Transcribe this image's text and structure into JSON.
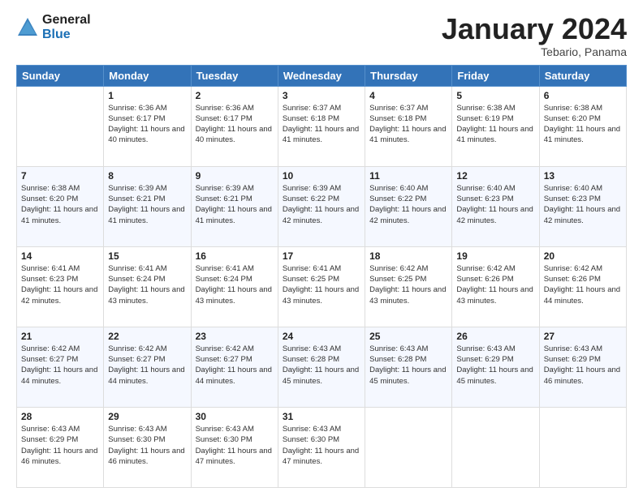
{
  "header": {
    "logo": {
      "general": "General",
      "blue": "Blue"
    },
    "title": "January 2024",
    "subtitle": "Tebario, Panama"
  },
  "calendar": {
    "days_of_week": [
      "Sunday",
      "Monday",
      "Tuesday",
      "Wednesday",
      "Thursday",
      "Friday",
      "Saturday"
    ],
    "weeks": [
      [
        {
          "day": "",
          "sunrise": "",
          "sunset": "",
          "daylight": ""
        },
        {
          "day": "1",
          "sunrise": "Sunrise: 6:36 AM",
          "sunset": "Sunset: 6:17 PM",
          "daylight": "Daylight: 11 hours and 40 minutes."
        },
        {
          "day": "2",
          "sunrise": "Sunrise: 6:36 AM",
          "sunset": "Sunset: 6:17 PM",
          "daylight": "Daylight: 11 hours and 40 minutes."
        },
        {
          "day": "3",
          "sunrise": "Sunrise: 6:37 AM",
          "sunset": "Sunset: 6:18 PM",
          "daylight": "Daylight: 11 hours and 41 minutes."
        },
        {
          "day": "4",
          "sunrise": "Sunrise: 6:37 AM",
          "sunset": "Sunset: 6:18 PM",
          "daylight": "Daylight: 11 hours and 41 minutes."
        },
        {
          "day": "5",
          "sunrise": "Sunrise: 6:38 AM",
          "sunset": "Sunset: 6:19 PM",
          "daylight": "Daylight: 11 hours and 41 minutes."
        },
        {
          "day": "6",
          "sunrise": "Sunrise: 6:38 AM",
          "sunset": "Sunset: 6:20 PM",
          "daylight": "Daylight: 11 hours and 41 minutes."
        }
      ],
      [
        {
          "day": "7",
          "sunrise": "Sunrise: 6:38 AM",
          "sunset": "Sunset: 6:20 PM",
          "daylight": "Daylight: 11 hours and 41 minutes."
        },
        {
          "day": "8",
          "sunrise": "Sunrise: 6:39 AM",
          "sunset": "Sunset: 6:21 PM",
          "daylight": "Daylight: 11 hours and 41 minutes."
        },
        {
          "day": "9",
          "sunrise": "Sunrise: 6:39 AM",
          "sunset": "Sunset: 6:21 PM",
          "daylight": "Daylight: 11 hours and 41 minutes."
        },
        {
          "day": "10",
          "sunrise": "Sunrise: 6:39 AM",
          "sunset": "Sunset: 6:22 PM",
          "daylight": "Daylight: 11 hours and 42 minutes."
        },
        {
          "day": "11",
          "sunrise": "Sunrise: 6:40 AM",
          "sunset": "Sunset: 6:22 PM",
          "daylight": "Daylight: 11 hours and 42 minutes."
        },
        {
          "day": "12",
          "sunrise": "Sunrise: 6:40 AM",
          "sunset": "Sunset: 6:23 PM",
          "daylight": "Daylight: 11 hours and 42 minutes."
        },
        {
          "day": "13",
          "sunrise": "Sunrise: 6:40 AM",
          "sunset": "Sunset: 6:23 PM",
          "daylight": "Daylight: 11 hours and 42 minutes."
        }
      ],
      [
        {
          "day": "14",
          "sunrise": "Sunrise: 6:41 AM",
          "sunset": "Sunset: 6:23 PM",
          "daylight": "Daylight: 11 hours and 42 minutes."
        },
        {
          "day": "15",
          "sunrise": "Sunrise: 6:41 AM",
          "sunset": "Sunset: 6:24 PM",
          "daylight": "Daylight: 11 hours and 43 minutes."
        },
        {
          "day": "16",
          "sunrise": "Sunrise: 6:41 AM",
          "sunset": "Sunset: 6:24 PM",
          "daylight": "Daylight: 11 hours and 43 minutes."
        },
        {
          "day": "17",
          "sunrise": "Sunrise: 6:41 AM",
          "sunset": "Sunset: 6:25 PM",
          "daylight": "Daylight: 11 hours and 43 minutes."
        },
        {
          "day": "18",
          "sunrise": "Sunrise: 6:42 AM",
          "sunset": "Sunset: 6:25 PM",
          "daylight": "Daylight: 11 hours and 43 minutes."
        },
        {
          "day": "19",
          "sunrise": "Sunrise: 6:42 AM",
          "sunset": "Sunset: 6:26 PM",
          "daylight": "Daylight: 11 hours and 43 minutes."
        },
        {
          "day": "20",
          "sunrise": "Sunrise: 6:42 AM",
          "sunset": "Sunset: 6:26 PM",
          "daylight": "Daylight: 11 hours and 44 minutes."
        }
      ],
      [
        {
          "day": "21",
          "sunrise": "Sunrise: 6:42 AM",
          "sunset": "Sunset: 6:27 PM",
          "daylight": "Daylight: 11 hours and 44 minutes."
        },
        {
          "day": "22",
          "sunrise": "Sunrise: 6:42 AM",
          "sunset": "Sunset: 6:27 PM",
          "daylight": "Daylight: 11 hours and 44 minutes."
        },
        {
          "day": "23",
          "sunrise": "Sunrise: 6:42 AM",
          "sunset": "Sunset: 6:27 PM",
          "daylight": "Daylight: 11 hours and 44 minutes."
        },
        {
          "day": "24",
          "sunrise": "Sunrise: 6:43 AM",
          "sunset": "Sunset: 6:28 PM",
          "daylight": "Daylight: 11 hours and 45 minutes."
        },
        {
          "day": "25",
          "sunrise": "Sunrise: 6:43 AM",
          "sunset": "Sunset: 6:28 PM",
          "daylight": "Daylight: 11 hours and 45 minutes."
        },
        {
          "day": "26",
          "sunrise": "Sunrise: 6:43 AM",
          "sunset": "Sunset: 6:29 PM",
          "daylight": "Daylight: 11 hours and 45 minutes."
        },
        {
          "day": "27",
          "sunrise": "Sunrise: 6:43 AM",
          "sunset": "Sunset: 6:29 PM",
          "daylight": "Daylight: 11 hours and 46 minutes."
        }
      ],
      [
        {
          "day": "28",
          "sunrise": "Sunrise: 6:43 AM",
          "sunset": "Sunset: 6:29 PM",
          "daylight": "Daylight: 11 hours and 46 minutes."
        },
        {
          "day": "29",
          "sunrise": "Sunrise: 6:43 AM",
          "sunset": "Sunset: 6:30 PM",
          "daylight": "Daylight: 11 hours and 46 minutes."
        },
        {
          "day": "30",
          "sunrise": "Sunrise: 6:43 AM",
          "sunset": "Sunset: 6:30 PM",
          "daylight": "Daylight: 11 hours and 47 minutes."
        },
        {
          "day": "31",
          "sunrise": "Sunrise: 6:43 AM",
          "sunset": "Sunset: 6:30 PM",
          "daylight": "Daylight: 11 hours and 47 minutes."
        },
        {
          "day": "",
          "sunrise": "",
          "sunset": "",
          "daylight": ""
        },
        {
          "day": "",
          "sunrise": "",
          "sunset": "",
          "daylight": ""
        },
        {
          "day": "",
          "sunrise": "",
          "sunset": "",
          "daylight": ""
        }
      ]
    ]
  }
}
